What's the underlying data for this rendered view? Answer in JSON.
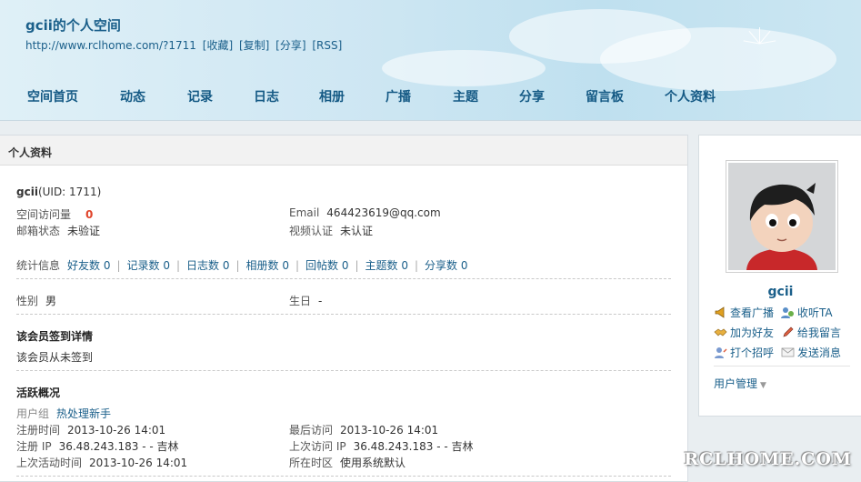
{
  "header": {
    "title": "gcii的个人空间",
    "url": "http://www.rclhome.com/?1711",
    "links": [
      "[收藏]",
      "[复制]",
      "[分享]",
      "[RSS]"
    ]
  },
  "nav": [
    "空间首页",
    "动态",
    "记录",
    "日志",
    "相册",
    "广播",
    "主题",
    "分享",
    "留言板",
    "个人资料"
  ],
  "main": {
    "heading": "个人资料",
    "username": "gcii",
    "uid": "(UID: 1711)",
    "visits_label": "空间访问量",
    "visits_value": "0",
    "email_label": "Email",
    "email_value": "464423619@qq.com",
    "mail_status_label": "邮箱状态",
    "mail_status_value": "未验证",
    "video_label": "视频认证",
    "video_value": "未认证",
    "stats_label": "统计信息",
    "stats": [
      "好友数 0",
      "记录数 0",
      "日志数 0",
      "相册数 0",
      "回帖数 0",
      "主题数 0",
      "分享数 0"
    ],
    "gender_label": "性别",
    "gender_value": "男",
    "birthday_label": "生日",
    "birthday_value": "-",
    "signin_title": "该会员签到详情",
    "signin_text": "该会员从未签到",
    "activity_title": "活跃概况",
    "group_label": "用户组",
    "group_value": "热处理新手",
    "reg_time_label": "注册时间",
    "reg_time_value": "2013-10-26 14:01",
    "last_visit_label": "最后访问",
    "last_visit_value": "2013-10-26 14:01",
    "reg_ip_label": "注册 IP",
    "reg_ip_value": "36.48.243.183 - - 吉林",
    "last_ip_label": "上次访问 IP",
    "last_ip_value": "36.48.243.183 - - 吉林",
    "last_active_label": "上次活动时间",
    "last_active_value": "2013-10-26 14:01",
    "timezone_label": "所在时区",
    "timezone_value": "使用系统默认"
  },
  "sidebar": {
    "username": "gcii",
    "actions": [
      "查看广播",
      "收听TA",
      "加为好友",
      "给我留言",
      "打个招呼",
      "发送消息"
    ],
    "manage": "用户管理"
  },
  "watermark": "RCLHOME.COM",
  "colors": {
    "link": "#1a5f8a",
    "accent_red": "#e0442a",
    "header_sky": "#cfe7f3"
  }
}
